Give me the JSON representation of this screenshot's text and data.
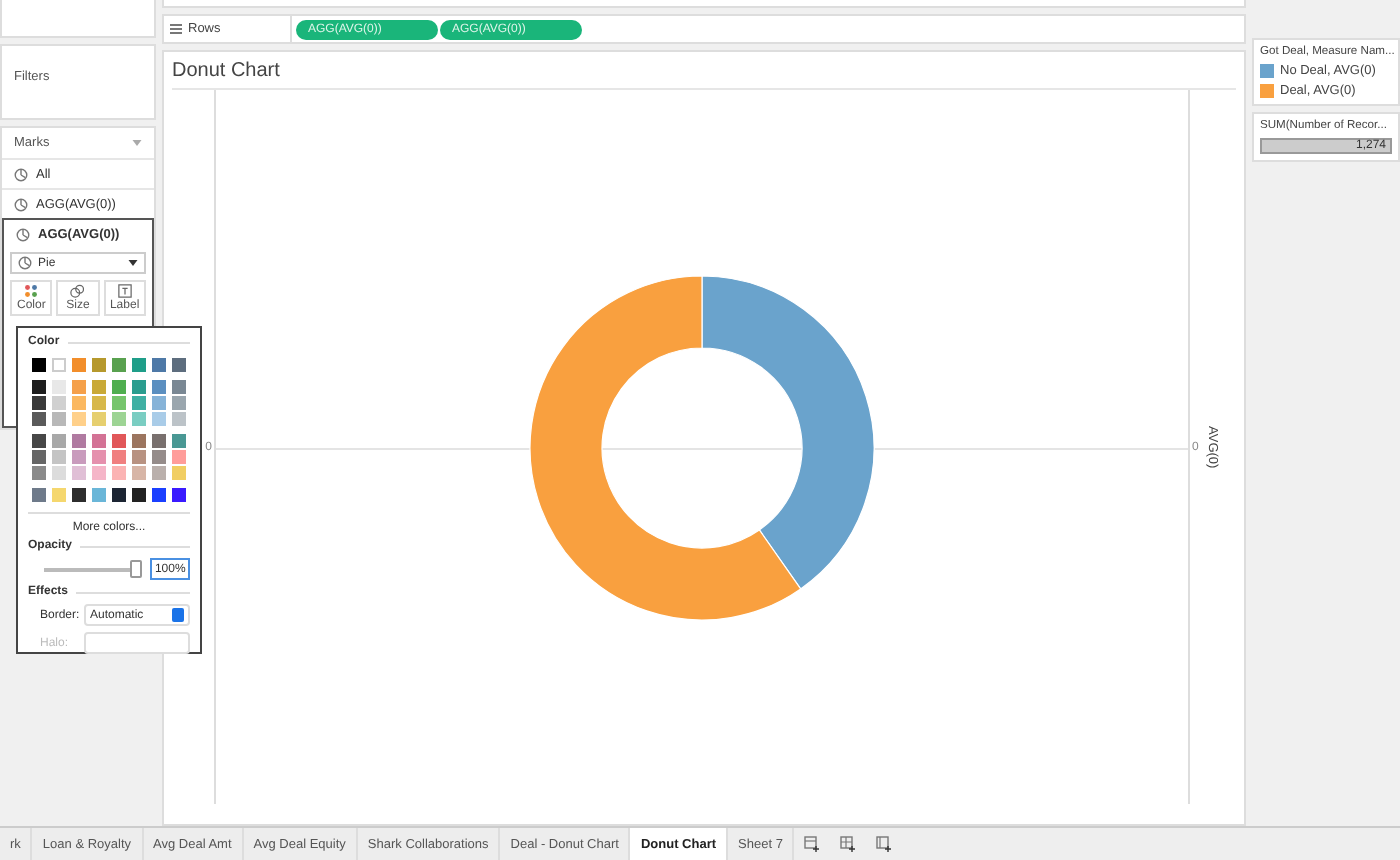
{
  "shelves": {
    "rows_label": "Rows",
    "rows_pills": [
      "AGG(AVG(0))",
      "AGG(AVG(0))"
    ]
  },
  "filters": {
    "title": "Filters"
  },
  "marks": {
    "title": "Marks",
    "cards": [
      {
        "label": "All",
        "selected": false
      },
      {
        "label": "AGG(AVG(0))",
        "selected": false
      },
      {
        "label": "AGG(AVG(0))",
        "selected": true
      }
    ],
    "mark_type": "Pie",
    "buttons": [
      "Color",
      "Size",
      "Label"
    ]
  },
  "color_popup": {
    "title": "Color",
    "more_colors": "More colors...",
    "opacity_label": "Opacity",
    "opacity": {
      "level": 1,
      "value": "100%"
    },
    "effects_label": "Effects",
    "border_label": "Border:",
    "border_value": "Automatic",
    "halo_label": "Halo:",
    "halo_disabled": true
  },
  "sheet": {
    "title": "Donut Chart",
    "left_axis_tick": "0",
    "right_axis_tick": "0",
    "right_axis_title": "AVG(0)"
  },
  "legend": {
    "title": "Got Deal, Measure Nam...",
    "items": [
      {
        "label": "No Deal, AVG(0)",
        "color": "#6aa3cc"
      },
      {
        "label": "Deal, AVG(0)",
        "color": "#f9a03f"
      }
    ]
  },
  "size_legend": {
    "title": "SUM(Number of Recor...",
    "value": "1,274"
  },
  "tabs": [
    {
      "label": "rk",
      "selected": false
    },
    {
      "label": "Loan & Royalty",
      "selected": false
    },
    {
      "label": "Avg Deal Amt",
      "selected": false
    },
    {
      "label": "Avg Deal Equity",
      "selected": false
    },
    {
      "label": "Shark Collaborations",
      "selected": false
    },
    {
      "label": "Deal - Donut Chart",
      "selected": false
    },
    {
      "label": "Donut Chart",
      "selected": true
    },
    {
      "label": "Sheet 7",
      "selected": false
    }
  ]
}
